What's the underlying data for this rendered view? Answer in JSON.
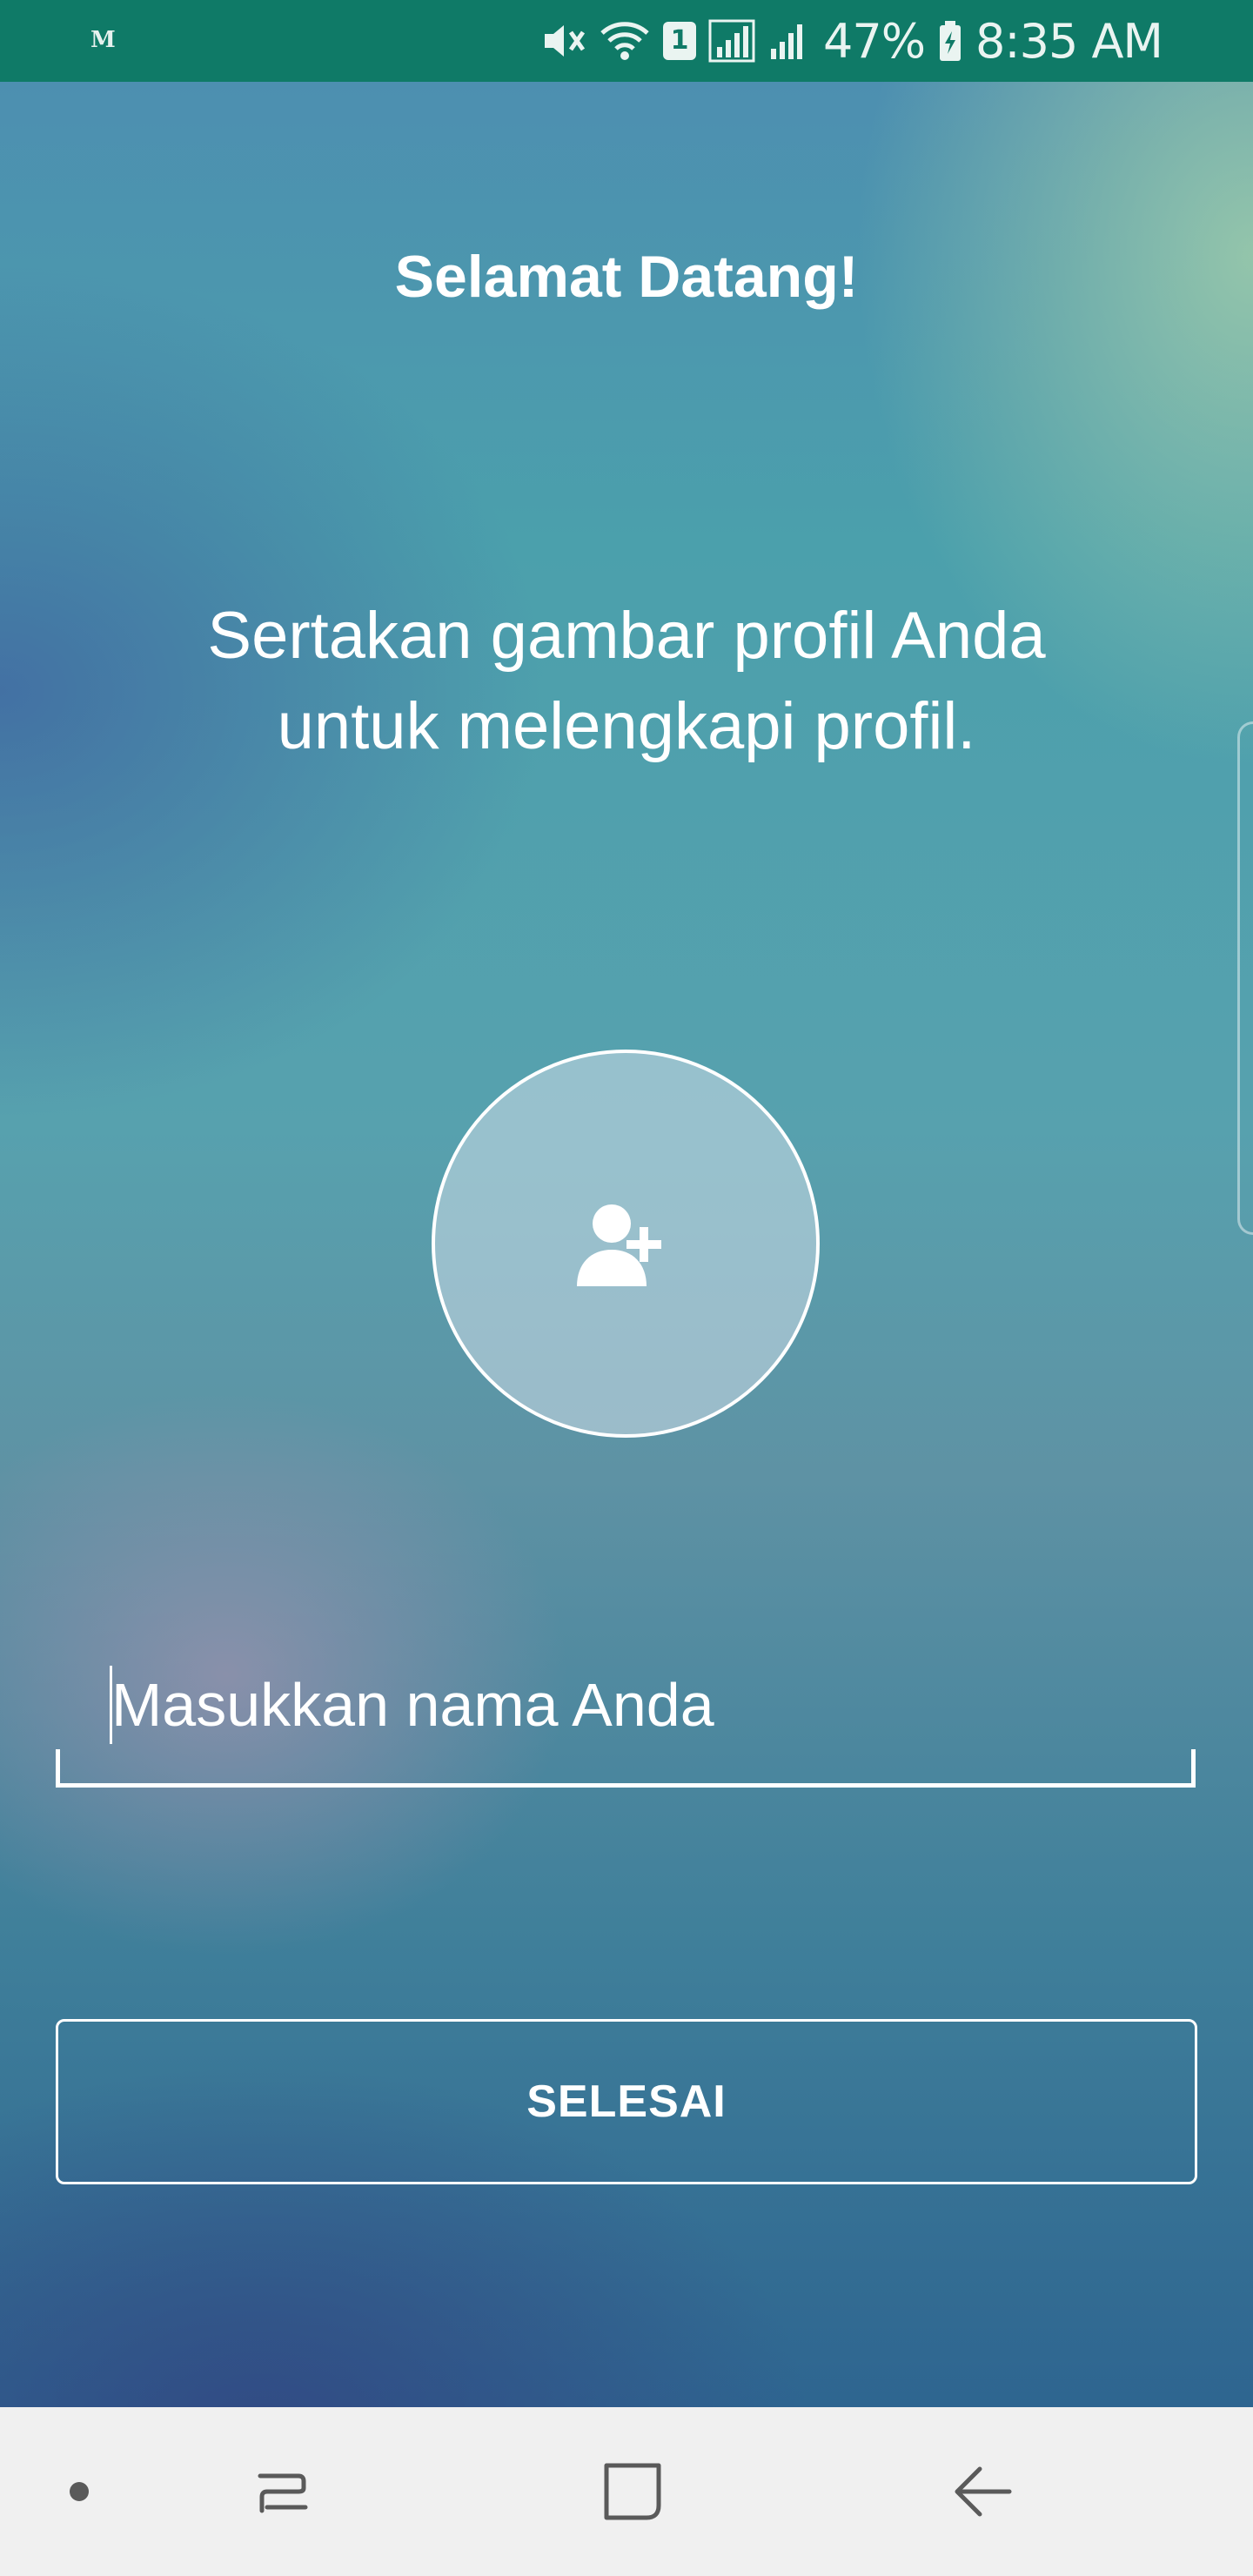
{
  "status_bar": {
    "battery": "47%",
    "time": "8:35 AM",
    "sim_slot": "1",
    "icons": [
      "mail-icon",
      "mute-icon",
      "wifi-icon",
      "sim-icon",
      "signal-icon",
      "signal-2-icon",
      "battery-charging-icon"
    ]
  },
  "screen": {
    "welcome": "Selamat Datang!",
    "subtitle_line1": "Sertakan gambar profil Anda",
    "subtitle_line2": "untuk melengkapi profil.",
    "avatar_icon": "add-person-icon",
    "name_placeholder": "Masukkan nama Anda",
    "done_label": "SELESAI"
  },
  "nav_bar": {
    "icons": [
      "dot-icon",
      "recents-icon",
      "home-icon",
      "back-icon"
    ],
    "background": "#f0f0f0"
  },
  "colors": {
    "status_bar": "#0f7a67",
    "text": "#ffffff"
  }
}
